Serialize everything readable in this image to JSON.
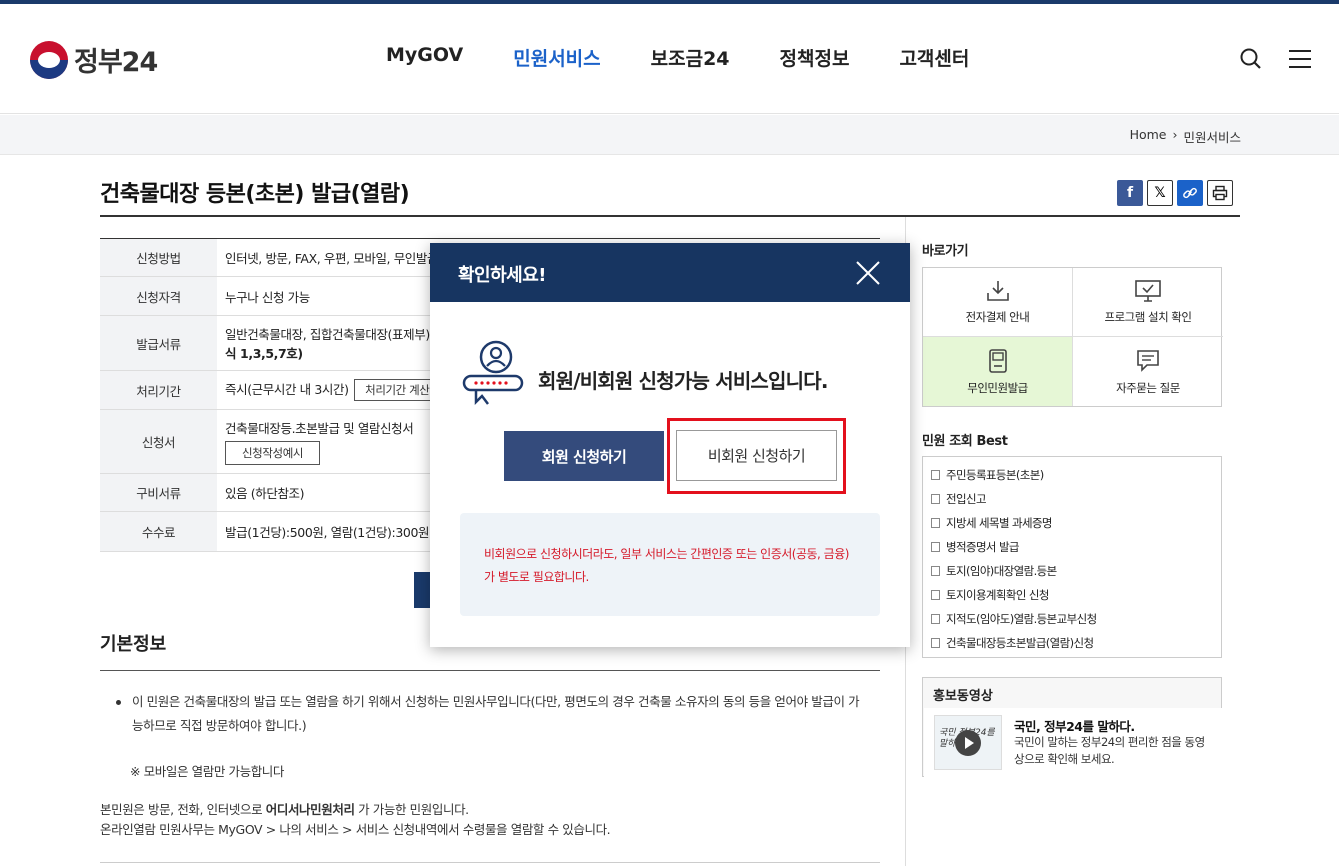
{
  "header": {
    "logo_text": "정부24",
    "nav": [
      "MyGOV",
      "민원서비스",
      "보조금24",
      "정책정보",
      "고객센터"
    ],
    "active_nav_index": 1
  },
  "breadcrumb": {
    "home": "Home",
    "sep": "›",
    "current": "민원서비스"
  },
  "page": {
    "title": "건축물대장 등본(초본) 발급(열람)"
  },
  "info_table": {
    "rows": [
      {
        "label": "신청방법",
        "value": "인터넷, 방문, FAX, 우편, 모바일, 무인발급기"
      },
      {
        "label": "신청자격",
        "value": "누구나 신청 가능"
      },
      {
        "label": "발급서류",
        "value": "일반건축물대장, 집합건축물대장(표제부), 집",
        "value2": "식 1,3,5,7호)"
      },
      {
        "label": "처리기간",
        "value": "즉시(근무시간 내 3시간)",
        "button": "처리기간 계산 방"
      },
      {
        "label": "신청서",
        "value": "건축물대장등.초본발급 및 열람신청서",
        "button": "신청작성예시"
      },
      {
        "label": "구비서류",
        "value": "있음 (하단참조)"
      },
      {
        "label": "수수료",
        "value": "발급(1건당):500원, 열람(1건당):300원, 인터"
      }
    ]
  },
  "basic_info": {
    "title": "기본정보",
    "bullet": "이 민원은 건축물대장의 발급 또는 열람을 하기 위해서 신청하는 민원사무입니다(다만, 평면도의 경우 건축물 소유자의 동의 등을 얻어야 발급이 가능하므로 직접 방문하여야 합니다.)",
    "note": "※ 모바일은 열람만 가능합니다",
    "line1_pre": "본민원은 방문, 전화, 인터넷으로 ",
    "line1_bold": "어디서나민원처리",
    "line1_post": " 가 가능한 민원입니다.",
    "line2": "온라인열람 민원사무는 MyGOV > 나의 서비스 > 서비스 신청내역에서 수령물을 열람할 수 있습니다."
  },
  "sidebar": {
    "quick_title": "바로가기",
    "quick_items": [
      {
        "label": "전자결제 안내",
        "icon": "download-icon"
      },
      {
        "label": "프로그램 설치 확인",
        "icon": "monitor-check-icon"
      },
      {
        "label": "무인민원발급",
        "icon": "kiosk-icon"
      },
      {
        "label": "자주묻는 질문",
        "icon": "chat-icon"
      }
    ],
    "best_title": "민원 조회 Best",
    "best_items": [
      "주민등록표등본(초본)",
      "전입신고",
      "지방세 세목별 과세증명",
      "병적증명서 발급",
      "토지(임야)대장열람.등본",
      "토지이용계획확인 신청",
      "지적도(임야도)열람.등본교부신청",
      "건축물대장등초본발급(열람)신청"
    ],
    "promo_title": "홍보동영상",
    "promo_video_title": "국민, 정부24를 말하다.",
    "promo_video_desc": "국민이 말하는 정부24의 편리한 점을 동영상으로 확인해 보세요.",
    "promo_thumb_text": "국민 정부24를 말하다"
  },
  "modal": {
    "title": "확인하세요!",
    "message": "회원/비회원 신청가능 서비스입니다.",
    "member_button": "회원 신청하기",
    "guest_button": "비회원 신청하기",
    "notice_line1": "비회원으로 신청하시더라도, 일부 서비스는 간편인증 또는 인증서(공동, 금융)",
    "notice_line2": "가 별도로 필요합니다."
  },
  "colors": {
    "brand_navy": "#173561",
    "active_nav": "#1b62c9",
    "notice_red": "#d51a2a",
    "highlight_red": "#e3101d"
  }
}
